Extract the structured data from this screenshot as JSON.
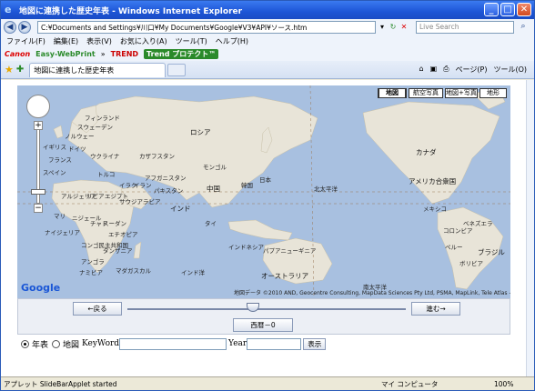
{
  "window": {
    "title": "地図に連携した歴史年表 - Windows Internet Explorer",
    "minimize": "_",
    "maximize": "□",
    "close": "✕"
  },
  "address": {
    "url": "C:¥Documents and Settings¥川口¥My Documents¥Google¥V3¥API¥ソース.htm",
    "search_placeholder": "Live Search"
  },
  "menu": [
    "ファイル(F)",
    "編集(E)",
    "表示(V)",
    "お気に入り(A)",
    "ツール(T)",
    "ヘルプ(H)"
  ],
  "toolbar": {
    "canon": "Canon",
    "ewp": "Easy-WebPrint",
    "trend": "TREND",
    "trend_protect": "Trend プロテクト™"
  },
  "tab": {
    "title": "地図に連携した歴史年表"
  },
  "command_bar": {
    "page": "ページ(P)",
    "tools": "ツール(O)"
  },
  "map": {
    "types": [
      "地図",
      "航空写真",
      "地図+写真",
      "地形"
    ],
    "attribution": "地図データ ©2010 AND, Geocentre Consulting, MapData Sciences Pty Ltd, PSMA, MapLink, Tele Atlas - 利用規約",
    "labels": {
      "finland": "フィンランド",
      "sweden": "スウェーデン",
      "norway": "ノルウェー",
      "uk": "イギリス",
      "germany": "ドイツ",
      "france": "フランス",
      "spain": "スペイン",
      "ukraine": "ウクライナ",
      "russia": "ロシア",
      "kazakhstan": "カザフスタン",
      "mongolia": "モンゴル",
      "turkey": "トルコ",
      "iraq": "イラク",
      "iran": "イラン",
      "afghanistan": "アフガニスタン",
      "pakistan": "パキスタン",
      "algeria": "アルジェリア",
      "libya": "リビア",
      "egypt": "エジプト",
      "saudi": "サウジアラビア",
      "china": "中国",
      "korea": "韓国",
      "japan": "日本",
      "india": "インド",
      "thailand": "タイ",
      "mali": "マリ",
      "niger": "ニジェール",
      "chad": "チャド",
      "sudan": "スーダン",
      "ethiopia": "エチオピア",
      "drc": "コンゴ民主共和国",
      "tanzania": "タンザニア",
      "nigeria": "ナイジェリア",
      "angola": "アンゴラ",
      "namibia": "ナミビア",
      "madagascar": "マダガスカル",
      "indonesia": "インドネシア",
      "png": "パプアニューギニア",
      "indian_ocean": "インド洋",
      "australia": "オーストラリア",
      "pacific_n": "北太平洋",
      "pacific_s": "南太平洋",
      "canada": "カナダ",
      "usa": "アメリカ合衆国",
      "mexico": "メキシコ",
      "venezuela": "ベネズエラ",
      "colombia": "コロンビア",
      "peru": "ペルー",
      "brazil": "ブラジル",
      "bolivia": "ボリビア",
      "google": "Google"
    }
  },
  "applet": {
    "back": "←戻る",
    "forward": "進む→",
    "year_label": "西暦－0",
    "position": 0.45
  },
  "form": {
    "radio_timeline": "年表",
    "radio_map": "地図",
    "keyword_label": "KeyWord",
    "year_label": "Year",
    "show_button": "表示"
  },
  "status": {
    "text": "アプレット SlideBarApplet started",
    "zone": "マイ コンピュータ",
    "zoom": "100%"
  }
}
